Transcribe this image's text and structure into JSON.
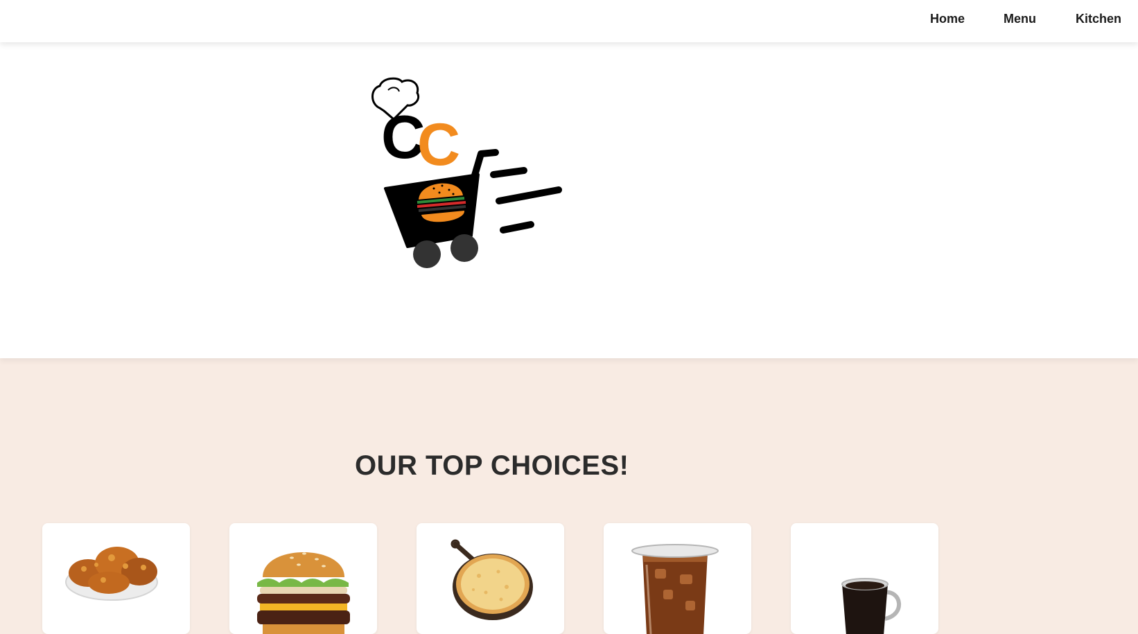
{
  "nav": {
    "links": [
      "Home",
      "Menu",
      "Kitchen"
    ]
  },
  "hero": {
    "logo_letters": "CC"
  },
  "top_choices": {
    "title": "OUR TOP CHOICES!",
    "items": [
      {
        "icon": "fried-chicken-icon"
      },
      {
        "icon": "burger-icon"
      },
      {
        "icon": "pizza-icon"
      },
      {
        "icon": "iced-cola-icon"
      },
      {
        "icon": "coffee-mug-icon"
      }
    ]
  },
  "colors": {
    "accent": "#f28b1e",
    "section_bg": "#f8ebe3",
    "text": "#2b2b2b"
  }
}
